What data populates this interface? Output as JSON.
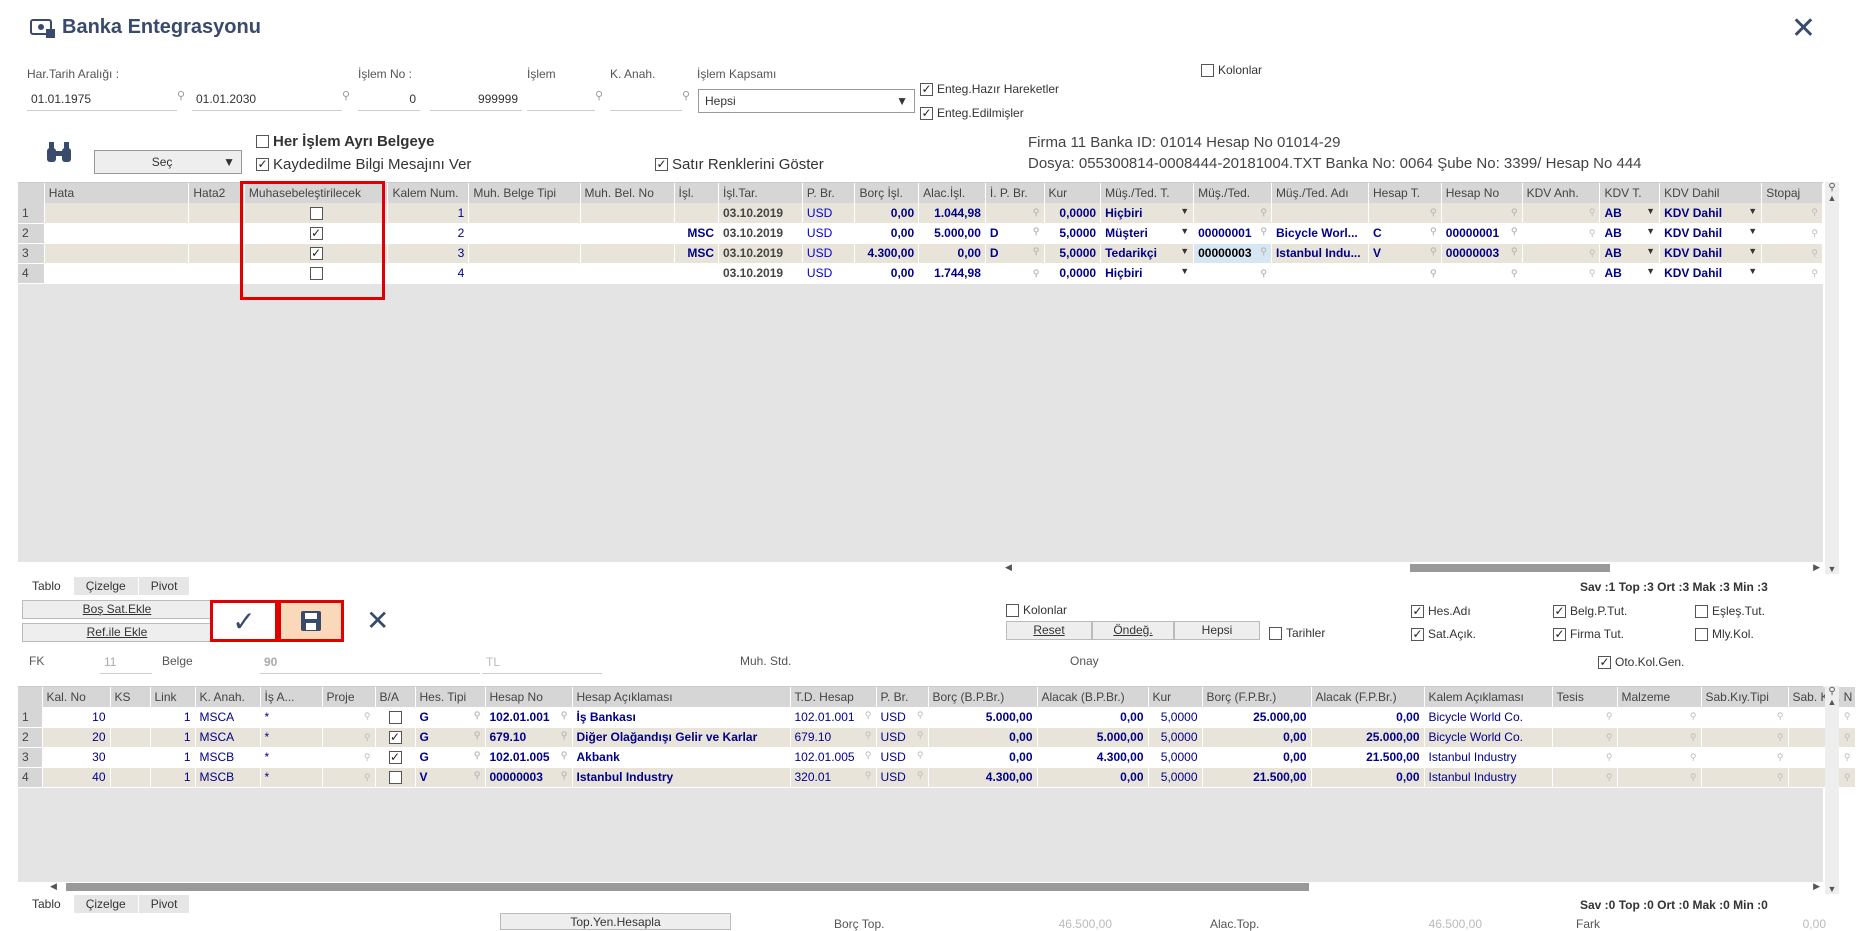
{
  "window": {
    "title": "Banka Entegrasyonu"
  },
  "filters": {
    "date_range_label": "Har.Tarih Aralığı :",
    "date_from": "01.01.1975",
    "date_to": "01.01.2030",
    "txn_no_label": "İşlem No :",
    "txn_no_from": "0",
    "txn_no_to": "999999",
    "txn_label": "İşlem",
    "k_anah_label": "K. Anah.",
    "scope_label": "İşlem Kapsamı",
    "scope_value": "Hepsi",
    "cb_ready": "Enteg.Hazır Hareketler",
    "cb_done": "Enteg.Edilmişler",
    "cb_columns": "Kolonlar",
    "select_btn": "Seç",
    "cb_each_doc": "Her İşlem Ayrı Belgeye",
    "cb_save_msg": "Kaydedilme Bilgi Mesajını Ver",
    "cb_row_colors": "Satır Renklerini Göster"
  },
  "info": {
    "line1": "Firma 11  Banka ID: 01014  Hesap No 01014-29",
    "line2": "Dosya: 055300814-0008444-20181004.TXT  Banka No: 0064  Şube No: 3399/  Hesap No 444"
  },
  "top_grid": {
    "headers": [
      "Hata",
      "Hata2",
      "Muhasebeleştirilecek",
      "Kalem Num.",
      "Muh. Belge Tipi",
      "Muh. Bel. No",
      "İşl.",
      "İşl.Tar.",
      "P. Br.",
      "Borç İşl.",
      "Alac.İşl.",
      "İ. P. Br.",
      "Kur",
      "Müş./Ted. T.",
      "Müş./Ted.",
      "Müş./Ted. Adı",
      "Hesap T.",
      "Hesap No",
      "KDV Anh.",
      "KDV T.",
      "KDV Dahil",
      "Stopaj"
    ],
    "rows": [
      {
        "n": "1",
        "check": false,
        "kalem": "1",
        "isl": "",
        "tarih": "03.10.2019",
        "pbr": "USD",
        "borc": "0,00",
        "alac": "1.044,98",
        "ipbr": "",
        "kur": "0,0000",
        "mt": "Hiçbiri",
        "m": "",
        "ma": "",
        "ht": "",
        "hn": "",
        "kdvt": "AB",
        "kdvd": "KDV Dahil"
      },
      {
        "n": "2",
        "check": true,
        "kalem": "2",
        "isl": "MSC",
        "tarih": "03.10.2019",
        "pbr": "USD",
        "borc": "0,00",
        "alac": "5.000,00",
        "ipbr": "D",
        "kur": "5,0000",
        "mt": "Müşteri",
        "m": "00000001",
        "ma": "Bicycle Worl...",
        "ht": "C",
        "hn": "00000001",
        "kdvt": "AB",
        "kdvd": "KDV Dahil"
      },
      {
        "n": "3",
        "check": true,
        "kalem": "3",
        "isl": "MSC",
        "tarih": "03.10.2019",
        "pbr": "USD",
        "borc": "4.300,00",
        "alac": "0,00",
        "ipbr": "D",
        "kur": "5,0000",
        "mt": "Tedarikçi",
        "m": "00000003",
        "ma": "Istanbul Indu...",
        "ht": "V",
        "hn": "00000003",
        "kdvt": "AB",
        "kdvd": "KDV Dahil"
      },
      {
        "n": "4",
        "check": false,
        "kalem": "4",
        "isl": "",
        "tarih": "03.10.2019",
        "pbr": "USD",
        "borc": "0,00",
        "alac": "1.744,98",
        "ipbr": "",
        "kur": "0,0000",
        "mt": "Hiçbiri",
        "m": "",
        "ma": "",
        "ht": "",
        "hn": "",
        "kdvt": "AB",
        "kdvd": "KDV Dahil"
      }
    ]
  },
  "tabs": [
    "Tablo",
    "Çizelge",
    "Pivot"
  ],
  "top_stats": "Sav :1  Top :3  Ort :3  Mak :3  Min :3",
  "actions": {
    "add_empty": "Boş Sat.Ekle",
    "add_ref": "Ref.ile Ekle",
    "cb_columns": "Kolonlar",
    "reset": "Reset",
    "default": "Öndeğ.",
    "all": "Hepsi",
    "cb_dates": "Tarihler",
    "cb_hes_adi": "Hes.Adı",
    "cb_sat_acik": "Sat.Açık.",
    "cb_belg": "Belg.P.Tut.",
    "cb_firma": "Firma Tut.",
    "cb_esles": "Eşleş.Tut.",
    "cb_mly": "Mly.Kol.",
    "cb_oto": "Oto.Kol.Gen."
  },
  "doc": {
    "fk_label": "FK",
    "fk_value": "11",
    "belge_label": "Belge",
    "belge_value": "90",
    "tl": "TL",
    "muh_std": "Muh. Std.",
    "onay": "Onay"
  },
  "bottom_grid": {
    "headers": [
      "Kal. No",
      "KS",
      "Link",
      "K. Anah.",
      "İş A...",
      "Proje",
      "B/A",
      "Hes. Tipi",
      "Hesap No",
      "Hesap Açıklaması",
      "T.D. Hesap",
      "P. Br.",
      "Borç (B.P.Br.)",
      "Alacak (B.P.Br.)",
      "Kur",
      "Borç (F.P.Br.)",
      "Alacak (F.P.Br.)",
      "Kalem Açıklaması",
      "Tesis",
      "Malzeme",
      "Sab.Kıy.Tipi",
      "Sab. Kıy. N"
    ],
    "rows": [
      {
        "n": "1",
        "kal": "10",
        "link": "1",
        "kanah": "MSCA",
        "is": "*",
        "ba": false,
        "tip": "G",
        "hn": "102.01.001",
        "ha": "İş Bankası",
        "td": "102.01.001",
        "pbr": "USD",
        "b1": "5.000,00",
        "a1": "0,00",
        "kur": "5,0000",
        "b2": "25.000,00",
        "a2": "0,00",
        "ka": "Bicycle World Co."
      },
      {
        "n": "2",
        "kal": "20",
        "link": "1",
        "kanah": "MSCA",
        "is": "*",
        "ba": true,
        "tip": "G",
        "hn": "679.10",
        "ha": "Diğer Olağandışı Gelir ve Karlar",
        "td": "679.10",
        "pbr": "USD",
        "b1": "0,00",
        "a1": "5.000,00",
        "kur": "5,0000",
        "b2": "0,00",
        "a2": "25.000,00",
        "ka": "Bicycle World Co."
      },
      {
        "n": "3",
        "kal": "30",
        "link": "1",
        "kanah": "MSCB",
        "is": "*",
        "ba": true,
        "tip": "G",
        "hn": "102.01.005",
        "ha": "Akbank",
        "td": "102.01.005",
        "pbr": "USD",
        "b1": "0,00",
        "a1": "4.300,00",
        "kur": "5,0000",
        "b2": "0,00",
        "a2": "21.500,00",
        "ka": "Istanbul Industry"
      },
      {
        "n": "4",
        "kal": "40",
        "link": "1",
        "kanah": "MSCB",
        "is": "*",
        "ba": false,
        "tip": "V",
        "hn": "00000003",
        "ha": "Istanbul Industry",
        "td": "320.01",
        "pbr": "USD",
        "b1": "4.300,00",
        "a1": "0,00",
        "kur": "5,0000",
        "b2": "21.500,00",
        "a2": "0,00",
        "ka": "Istanbul Industry"
      }
    ]
  },
  "bottom_stats": "Sav :0  Top :0  Ort :0  Mak :0  Min :0",
  "footer": {
    "btn": "Top.Yen.Hesapla",
    "borc_label": "Borç Top.",
    "borc": "46.500,00",
    "alac_label": "Alac.Top.",
    "alac": "46.500,00",
    "fark_label": "Fark",
    "fark": "0,00"
  }
}
